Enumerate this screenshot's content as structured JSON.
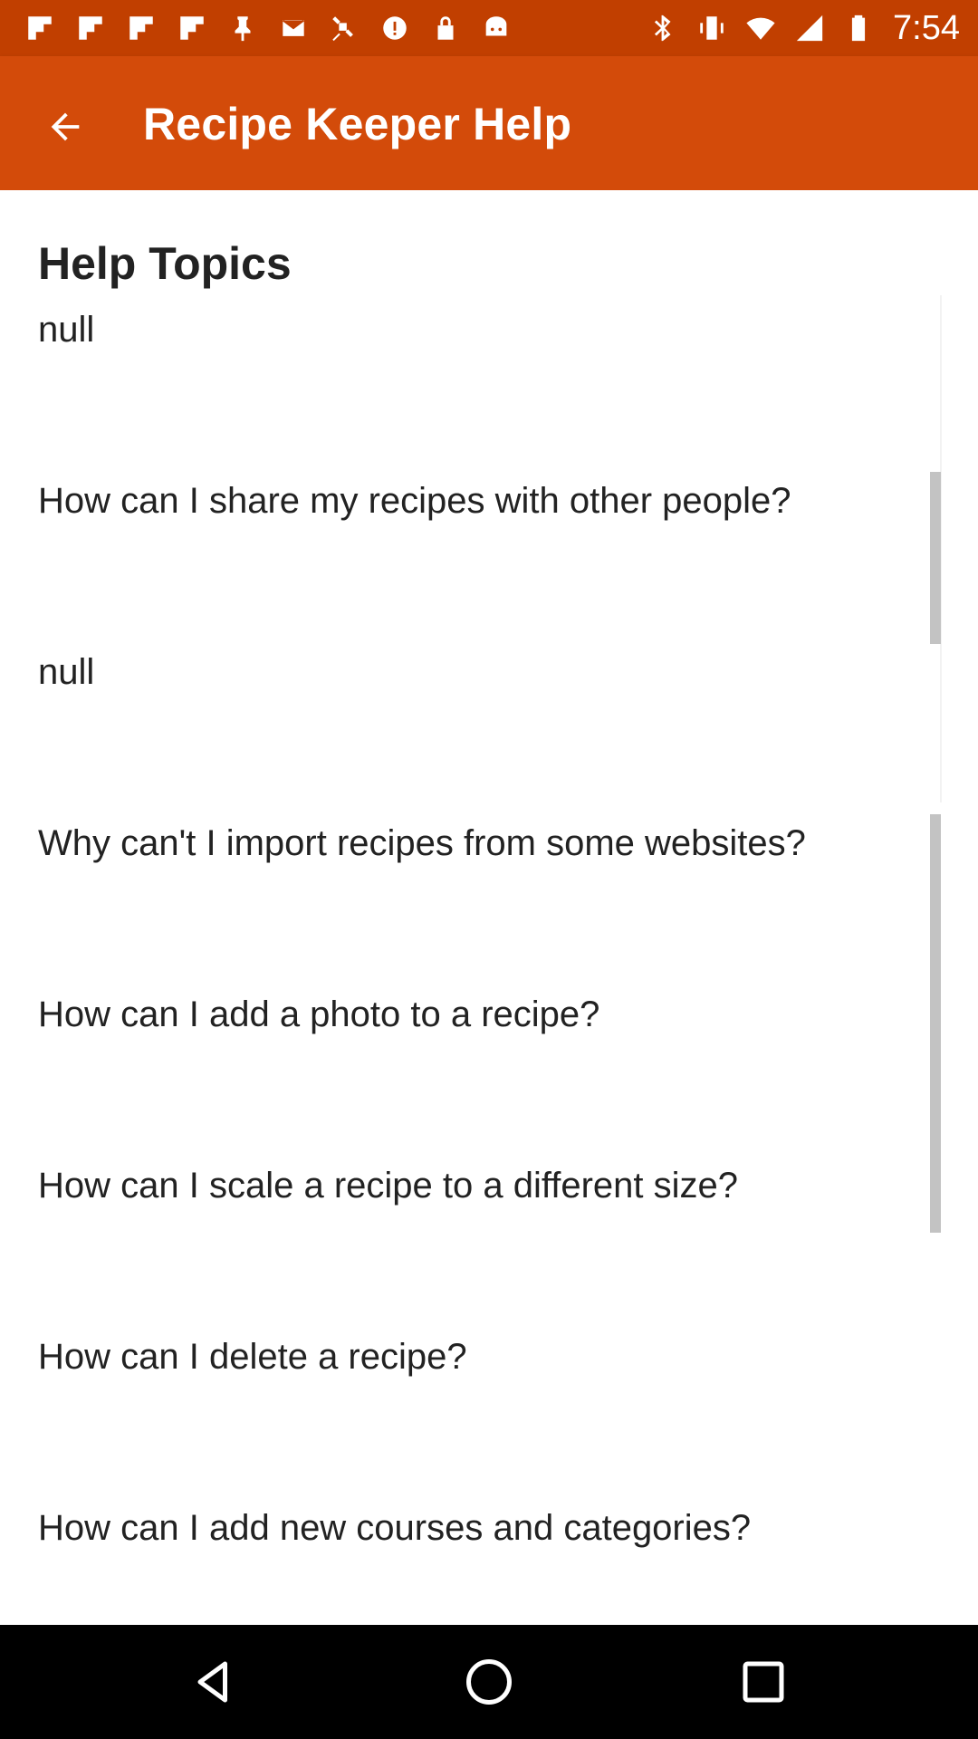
{
  "status_bar": {
    "time": "7:54",
    "left_icons": [
      "flipboard-icon",
      "flipboard-icon",
      "flipboard-icon",
      "flipboard-icon",
      "pin-icon",
      "mail-icon",
      "satellite-icon",
      "info-icon",
      "lock-icon",
      "android-icon"
    ],
    "right_icons": [
      "bluetooth-icon",
      "vibrate-icon",
      "wifi-icon",
      "signal-icon",
      "battery-icon"
    ]
  },
  "app_bar": {
    "title": "Recipe Keeper Help",
    "back_icon": "arrow-back-icon"
  },
  "help": {
    "section_title": "Help Topics",
    "topics": [
      "null",
      "How can I share my recipes with other people?",
      "null",
      "Why can't I import recipes from some websites?",
      "How can I add a photo to a recipe?",
      "How can I scale a recipe to a different size?",
      "How can I delete a recipe?",
      "How can I add new courses and categories?"
    ]
  },
  "nav_bar": {
    "icons": [
      "back-triangle-icon",
      "home-circle-icon",
      "recents-square-icon"
    ]
  },
  "colors": {
    "status_bar": "#c13f00",
    "app_bar": "#d34b0a",
    "text": "#222222",
    "scrollbar": "#c3c3c3"
  }
}
